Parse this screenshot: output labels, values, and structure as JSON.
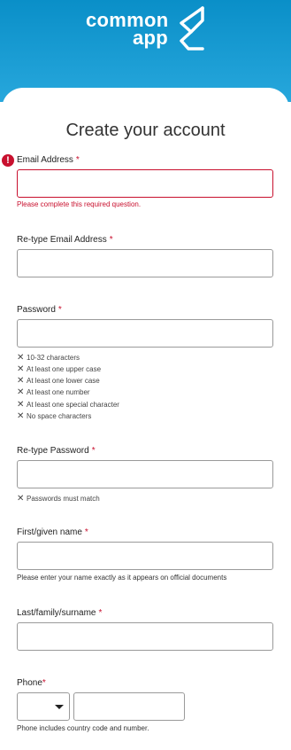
{
  "brand": {
    "line1": "common",
    "line2": "app"
  },
  "title": "Create your account",
  "error_icon": "!",
  "email": {
    "label": "Email Address",
    "required": "*",
    "error": "Please complete this required question."
  },
  "email_confirm": {
    "label": "Re-type Email Address",
    "required": "*"
  },
  "password": {
    "label": "Password",
    "required": "*",
    "rules": [
      "10-32 characters",
      "At least one upper case",
      "At least one lower case",
      "At least one number",
      "At least one special character",
      "No space characters"
    ]
  },
  "password_confirm": {
    "label": "Re-type Password",
    "required": "*",
    "rule": "Passwords must match"
  },
  "first_name": {
    "label": "First/given name",
    "required": "*",
    "hint": "Please enter your name exactly as it appears on official documents"
  },
  "last_name": {
    "label": "Last/family/surname",
    "required": "*"
  },
  "phone": {
    "label": "Phone",
    "required": "*",
    "hint": "Phone includes country code and number."
  },
  "icons": {
    "rule_status": "x-icon",
    "error": "error-icon"
  },
  "colors": {
    "header": "#0a8fc8",
    "error": "#c8102e"
  }
}
